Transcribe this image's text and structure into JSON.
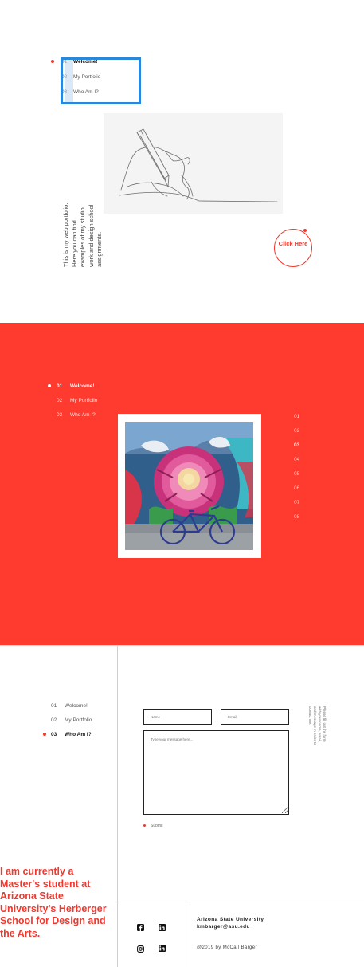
{
  "nav": {
    "items": [
      {
        "num": "01",
        "label": "Welcome!"
      },
      {
        "num": "02",
        "label": "My Portfolio"
      },
      {
        "num": "03",
        "label": "Who Am I?"
      }
    ]
  },
  "hero": {
    "intro": "This is my web portfolio. Here you can find examples of my studio work and design school assignments.",
    "cta": "Click Here"
  },
  "portfolio": {
    "slides": [
      "01",
      "02",
      "03",
      "04",
      "05",
      "06",
      "07",
      "08"
    ],
    "active_slide": "03"
  },
  "about": {
    "bio": "I am currently a Master's student at Arizona State University's Herberger School for Design and the Arts."
  },
  "contact": {
    "name_placeholder": "Name",
    "email_placeholder": "Email",
    "message_placeholder": "Type your message here...",
    "note": "Please fill out the form with your name, email, and message in order to contact me.",
    "submit_label": "Submit"
  },
  "footer": {
    "university": "Arizona State University",
    "email": "kmbarger@asu.edu",
    "copyright": "@2019 by McCall Barger",
    "social_icons": [
      "facebook-icon",
      "linkedin-icon",
      "instagram-icon",
      "linkedin-icon"
    ]
  },
  "colors": {
    "accent": "#ff3b2f",
    "focus": "#2b87d8"
  }
}
